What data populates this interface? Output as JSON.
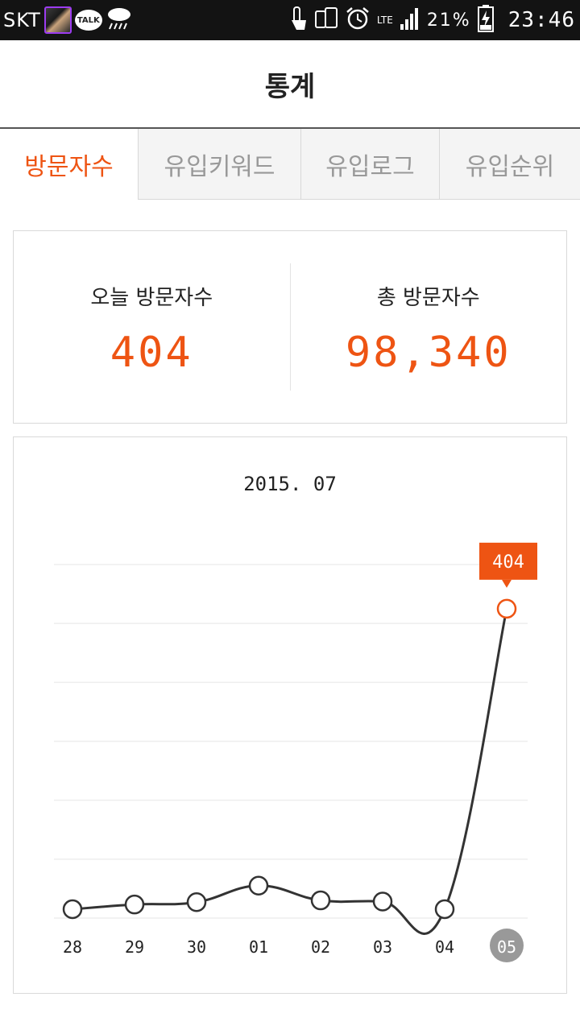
{
  "status_bar": {
    "carrier": "SKT",
    "talk_label": "TALK",
    "network": "LTE",
    "battery": "21%",
    "time": "23:46"
  },
  "header": {
    "title": "통계"
  },
  "tabs": [
    {
      "label": "방문자수",
      "active": true
    },
    {
      "label": "유입키워드",
      "active": false
    },
    {
      "label": "유입로그",
      "active": false
    },
    {
      "label": "유입순위",
      "active": false
    }
  ],
  "summary": {
    "today_label": "오늘 방문자수",
    "today_value": "404",
    "total_label": "총 방문자수",
    "total_value": "98,340"
  },
  "colors": {
    "accent": "#ee5413",
    "line": "#333333",
    "selected_day_bg": "#999999"
  },
  "chart_data": {
    "type": "line",
    "title": "2015. 07",
    "categories": [
      "28",
      "29",
      "30",
      "01",
      "02",
      "03",
      "04",
      "05"
    ],
    "values": [
      15,
      23,
      27,
      55,
      30,
      28,
      15,
      525
    ],
    "ylim": [
      0,
      600
    ],
    "grid": true,
    "selected_index": 7,
    "tooltip_label": "404"
  }
}
